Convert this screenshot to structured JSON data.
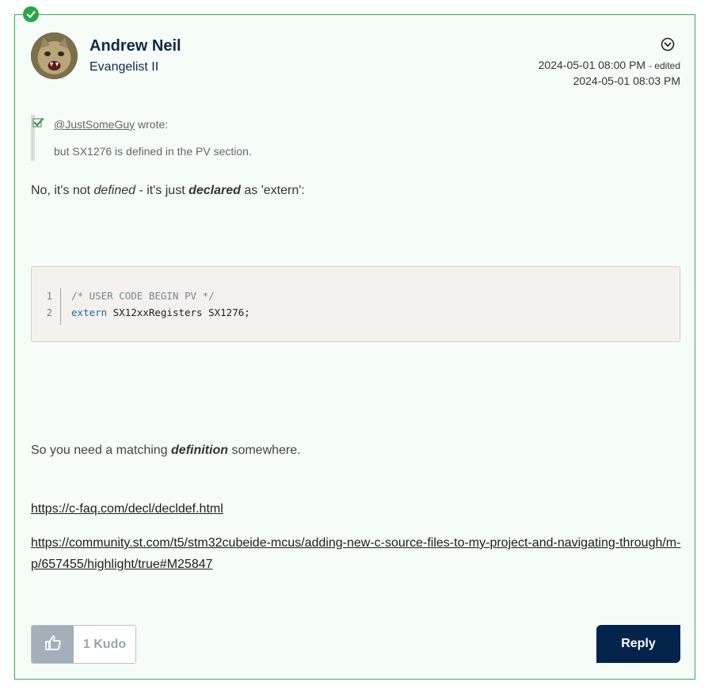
{
  "post": {
    "author": {
      "name": "Andrew Neil",
      "rank": "Evangelist II"
    },
    "dates": {
      "posted": "2024-05-01 08:00 PM",
      "edited_label": "- edited",
      "edited": "2024-05-01 08:03 PM"
    },
    "quote": {
      "mention": "@JustSomeGuy",
      "wrote": "wrote:",
      "text": "but SX1276 is defined in the PV section."
    },
    "paragraph1": {
      "t1": "No, it's not ",
      "em1": "defined",
      "t2": " - it's just ",
      "em2": "declared",
      "t3": " as 'extern':"
    },
    "code": {
      "lines": [
        {
          "num": "1",
          "comment": "/* USER CODE BEGIN PV */"
        },
        {
          "num": "2",
          "keyword": "extern",
          "rest": " SX12xxRegisters SX1276;"
        }
      ]
    },
    "paragraph2": {
      "t1": "So you need a matching ",
      "em": "definition",
      "t2": " somewhere."
    },
    "links": [
      "https://c-faq.com/decl/decldef.html",
      "https://community.st.com/t5/stm32cubeide-mcus/adding-new-c-source-files-to-my-project-and-navigating-through/m-p/657455/highlight/true#M25847"
    ],
    "kudo": {
      "count_label": "1 Kudo"
    },
    "reply_label": "Reply"
  },
  "colors": {
    "accent_green": "#27a74a",
    "reply_bg": "#03234b",
    "border_green": "#3aaa5c"
  },
  "icons": [
    "accepted-solution-icon",
    "options-menu-icon",
    "quote-check-icon",
    "thumbs-up-icon"
  ]
}
